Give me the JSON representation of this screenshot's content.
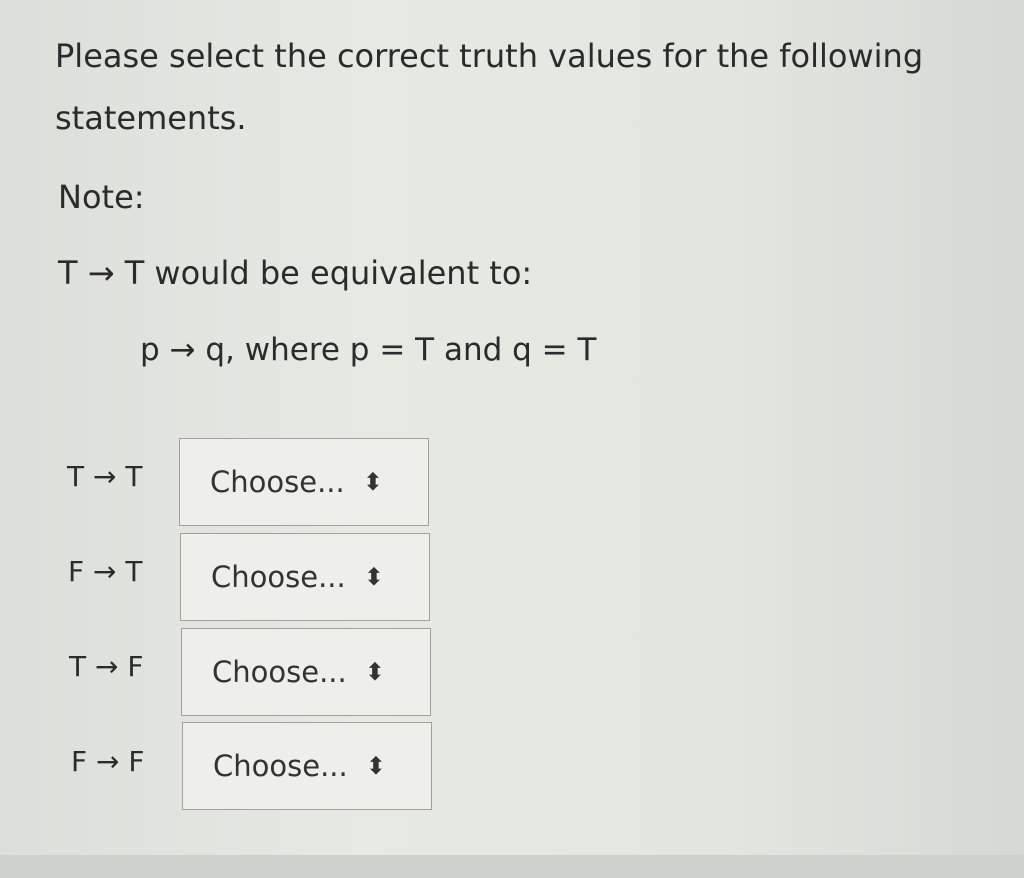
{
  "prompt": {
    "line1": "Please select the correct truth values for the following",
    "line2": "statements.",
    "note_label": "Note:",
    "example": "T → T would be equivalent to:",
    "formula": "p → q, where p = T and q = T"
  },
  "rows": [
    {
      "label": "T → T",
      "select": {
        "value": "Choose...",
        "arrows": "⬍"
      }
    },
    {
      "label": "F → T",
      "select": {
        "value": "Choose...",
        "arrows": "⬍"
      }
    },
    {
      "label": "T → F",
      "select": {
        "value": "Choose...",
        "arrows": "⬍"
      }
    },
    {
      "label": "F → F",
      "select": {
        "value": "Choose...",
        "arrows": "⬍"
      }
    }
  ]
}
